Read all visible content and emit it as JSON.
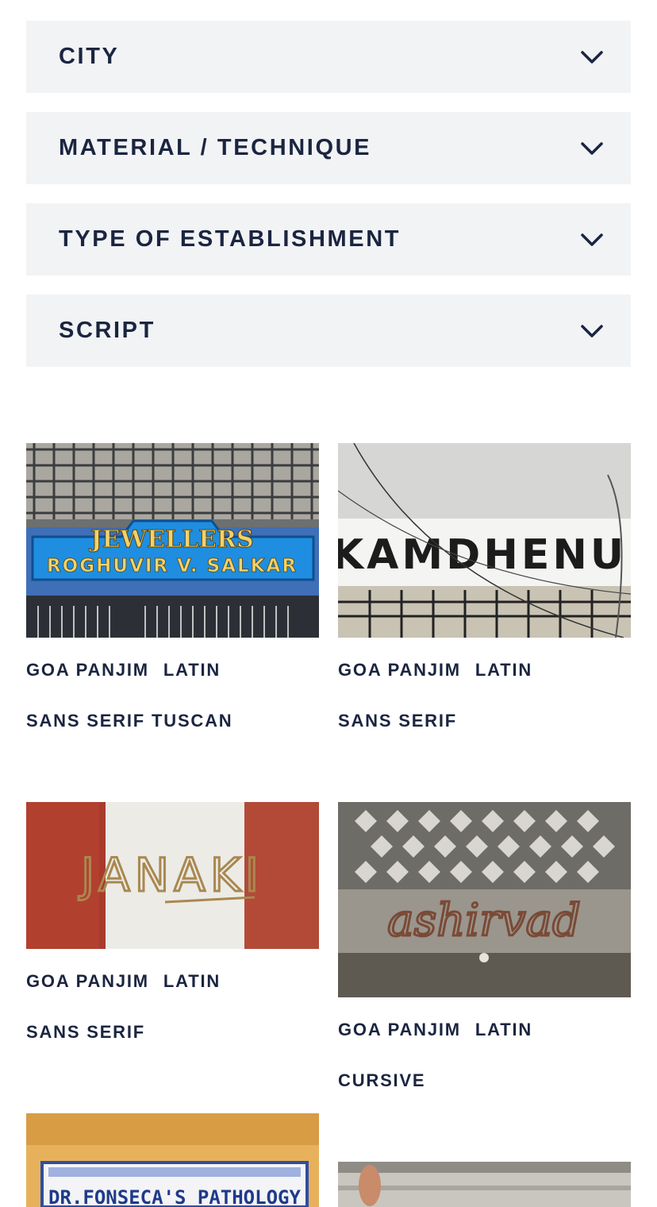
{
  "filters": [
    {
      "label": "CITY",
      "icon": "chevron-down-icon"
    },
    {
      "label": "MATERIAL / TECHNIQUE",
      "icon": "chevron-down-icon"
    },
    {
      "label": "TYPE OF ESTABLISHMENT",
      "icon": "chevron-down-icon"
    },
    {
      "label": "SCRIPT",
      "icon": "chevron-down-icon"
    }
  ],
  "signs": [
    {
      "photo_text": [
        "JEWELLERS",
        "ROGHUVIR V. SALKAR"
      ],
      "city": "GOA PANJIM",
      "script": "LATIN",
      "styles": [
        "SANS SERIF",
        "TUSCAN"
      ]
    },
    {
      "photo_text": [
        "KAMDHENU"
      ],
      "city": "GOA PANJIM",
      "script": "LATIN",
      "styles": [
        "SANS SERIF"
      ]
    },
    {
      "photo_text": [
        "JANAKI"
      ],
      "city": "GOA PANJIM",
      "script": "LATIN",
      "styles": [
        "SANS SERIF"
      ]
    },
    {
      "photo_text": [
        "ashirvad"
      ],
      "city": "GOA PANJIM",
      "script": "LATIN",
      "styles": [
        "CURSIVE"
      ]
    },
    {
      "photo_text": [
        "DR.FONSECA'S PATHOLOGY"
      ]
    }
  ],
  "colors": {
    "text": "#1b2540",
    "filter_bg": "#f1f3f5"
  }
}
